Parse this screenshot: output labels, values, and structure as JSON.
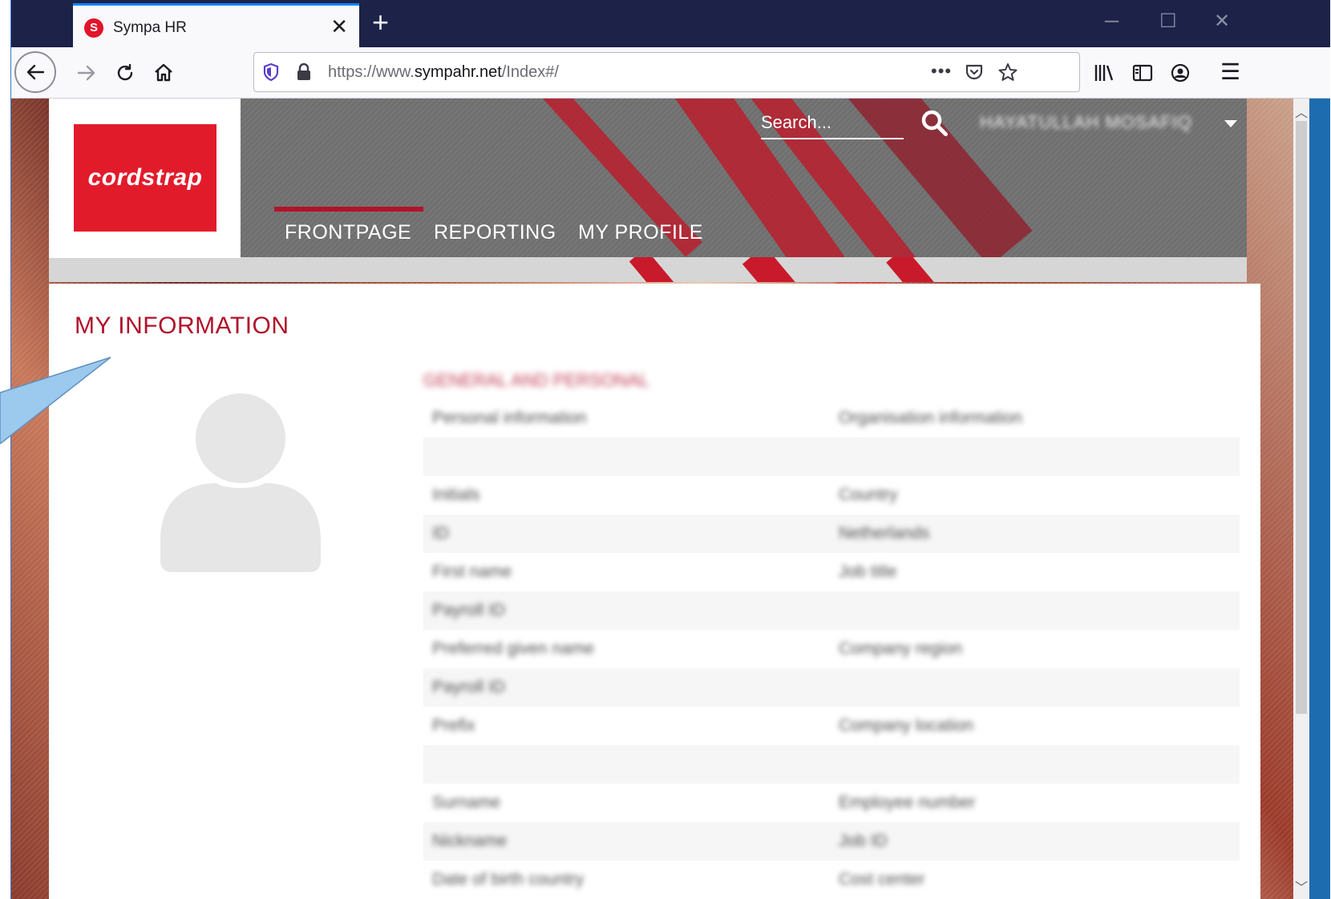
{
  "browser": {
    "tab": {
      "favicon": "S",
      "title": "Sympa HR",
      "close_glyph": "✕"
    },
    "new_tab_glyph": "+",
    "window_controls": {
      "minimize": "─",
      "maximize": "☐",
      "close": "✕"
    },
    "toolbar": {
      "back_glyph": "←",
      "forward_glyph": "→",
      "reload_glyph": "↻",
      "home_glyph": "⌂",
      "url_prefix": "https://www.",
      "url_domain": "sympahr.net",
      "url_path": "/Index#/",
      "page_actions_glyph": "•••",
      "menu_glyph": "☰",
      "icons": [
        "shield-icon",
        "lock-icon",
        "pocket-icon",
        "star-icon",
        "library-icon",
        "sidebar-icon",
        "account-icon",
        "menu-icon"
      ]
    }
  },
  "site": {
    "logo_text": "cordstrap",
    "search_placeholder": "Search...",
    "user_name": "HAYATULLAH MOSAFIQ",
    "nav": [
      {
        "label": "FRONTPAGE",
        "active": true
      },
      {
        "label": "REPORTING",
        "active": false
      },
      {
        "label": "MY PROFILE",
        "active": false
      }
    ],
    "accent_color": "#b0122a",
    "logo_color": "#e21b2b"
  },
  "card": {
    "title": "MY INFORMATION",
    "section_heading": "GENERAL AND PERSONAL",
    "rows": [
      {
        "key": "Personal information",
        "value": "Organisation information"
      },
      {
        "key": "",
        "value": ""
      },
      {
        "key": "Initials",
        "value": "Country"
      },
      {
        "key": "ID",
        "value": "Netherlands"
      },
      {
        "key": "First name",
        "value": "Job title"
      },
      {
        "key": "Payroll ID",
        "value": ""
      },
      {
        "key": "Preferred given name",
        "value": "Company region"
      },
      {
        "key": "Payroll ID",
        "value": ""
      },
      {
        "key": "Prefix",
        "value": "Company location"
      },
      {
        "key": "",
        "value": ""
      },
      {
        "key": "Surname",
        "value": "Employee number"
      },
      {
        "key": "Nickname",
        "value": "Job ID"
      },
      {
        "key": "Date of birth country",
        "value": "Cost center"
      }
    ]
  }
}
